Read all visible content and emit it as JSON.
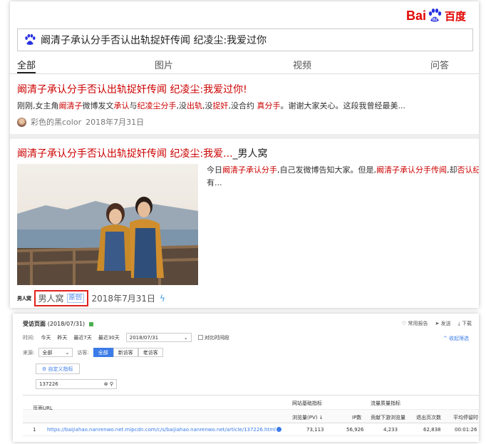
{
  "baidu": {
    "logo_left": "Bai",
    "logo_right": "百度",
    "query": "阚清子承认分手否认出轨捉奸传闻 纪凌尘:我爱过你",
    "tabs": [
      "全部",
      "图片",
      "视频",
      "问答"
    ],
    "result1": {
      "title": "阚清子承认分手否认出轨捉奸传闻 纪凌尘:我爱过你!",
      "snippet": [
        {
          "t": "刚刚,女主角",
          "h": false
        },
        {
          "t": "阚清子",
          "h": true
        },
        {
          "t": "微博发文",
          "h": false
        },
        {
          "t": "承认",
          "h": true
        },
        {
          "t": "与",
          "h": false
        },
        {
          "t": "纪凌尘分手",
          "h": true
        },
        {
          "t": ",没",
          "h": false
        },
        {
          "t": "出轨",
          "h": true
        },
        {
          "t": ",没",
          "h": false
        },
        {
          "t": "捉奸",
          "h": true
        },
        {
          "t": ",没合约 ",
          "h": false
        },
        {
          "t": "真分手",
          "h": true
        },
        {
          "t": "。谢谢大家关心。这段我曾经最美...",
          "h": false
        }
      ],
      "author": "彩色的黑color",
      "date": "2018年7月31日"
    },
    "result2": {
      "title_red": "阚清子承认分手否认出轨捉奸传闻 纪凌尘:我爱...",
      "title_plain": "_男人窝",
      "snippet_line1": [
        {
          "t": "今日",
          "h": false
        },
        {
          "t": "阚清子承认分手",
          "h": true
        },
        {
          "t": ",自己发微博告知大家。但是,",
          "h": false
        },
        {
          "t": "阚清子承认分手传闻",
          "h": true
        },
        {
          "t": ",却",
          "h": false
        },
        {
          "t": "否认纪凌尘",
          "h": true
        }
      ],
      "snippet_line2": "有...",
      "source_logo": "男人窝",
      "site": "男人窝",
      "original_tag": "原创",
      "date": "2018年7月31日"
    }
  },
  "analytics": {
    "title": "受访页面",
    "date": "(2018/07/31)",
    "tools": [
      "常用报告",
      "发送",
      "下载"
    ],
    "collapse": "收起筛选",
    "time_label": "时间:",
    "time_options": [
      "今天",
      "昨天",
      "最近7天",
      "最近30天"
    ],
    "date_value": "2018/07/31",
    "compare": "对比时间段",
    "source_label": "来源:",
    "source_value": "全部",
    "visitor_label": "访客:",
    "visitor_options": [
      "全部",
      "新访客",
      "老访客"
    ],
    "custom_metric": "自定义指标",
    "search_value": "137226",
    "col_url": "页面URL",
    "group1": "网站基础指标",
    "group2": "流量质量指标",
    "cols": [
      "浏览量(PV)",
      "IP数",
      "贡献下游浏览量",
      "退出页次数",
      "平均停留时长"
    ],
    "row": {
      "index": "1",
      "url": "https://baijiahao.nanrenwo.net.mipcdn.com/c/s/baijiahao.nanrenwo.net/article/137226.html",
      "pv": "73,113",
      "ip": "56,926",
      "downstream": "4,233",
      "exits": "62,838",
      "avg_time": "00:01:26"
    }
  },
  "colors": {
    "baidu_red": "#e10602",
    "highlight_red": "#cc0000",
    "link_blue": "#3b7be8",
    "red_box": "#e0211d"
  }
}
